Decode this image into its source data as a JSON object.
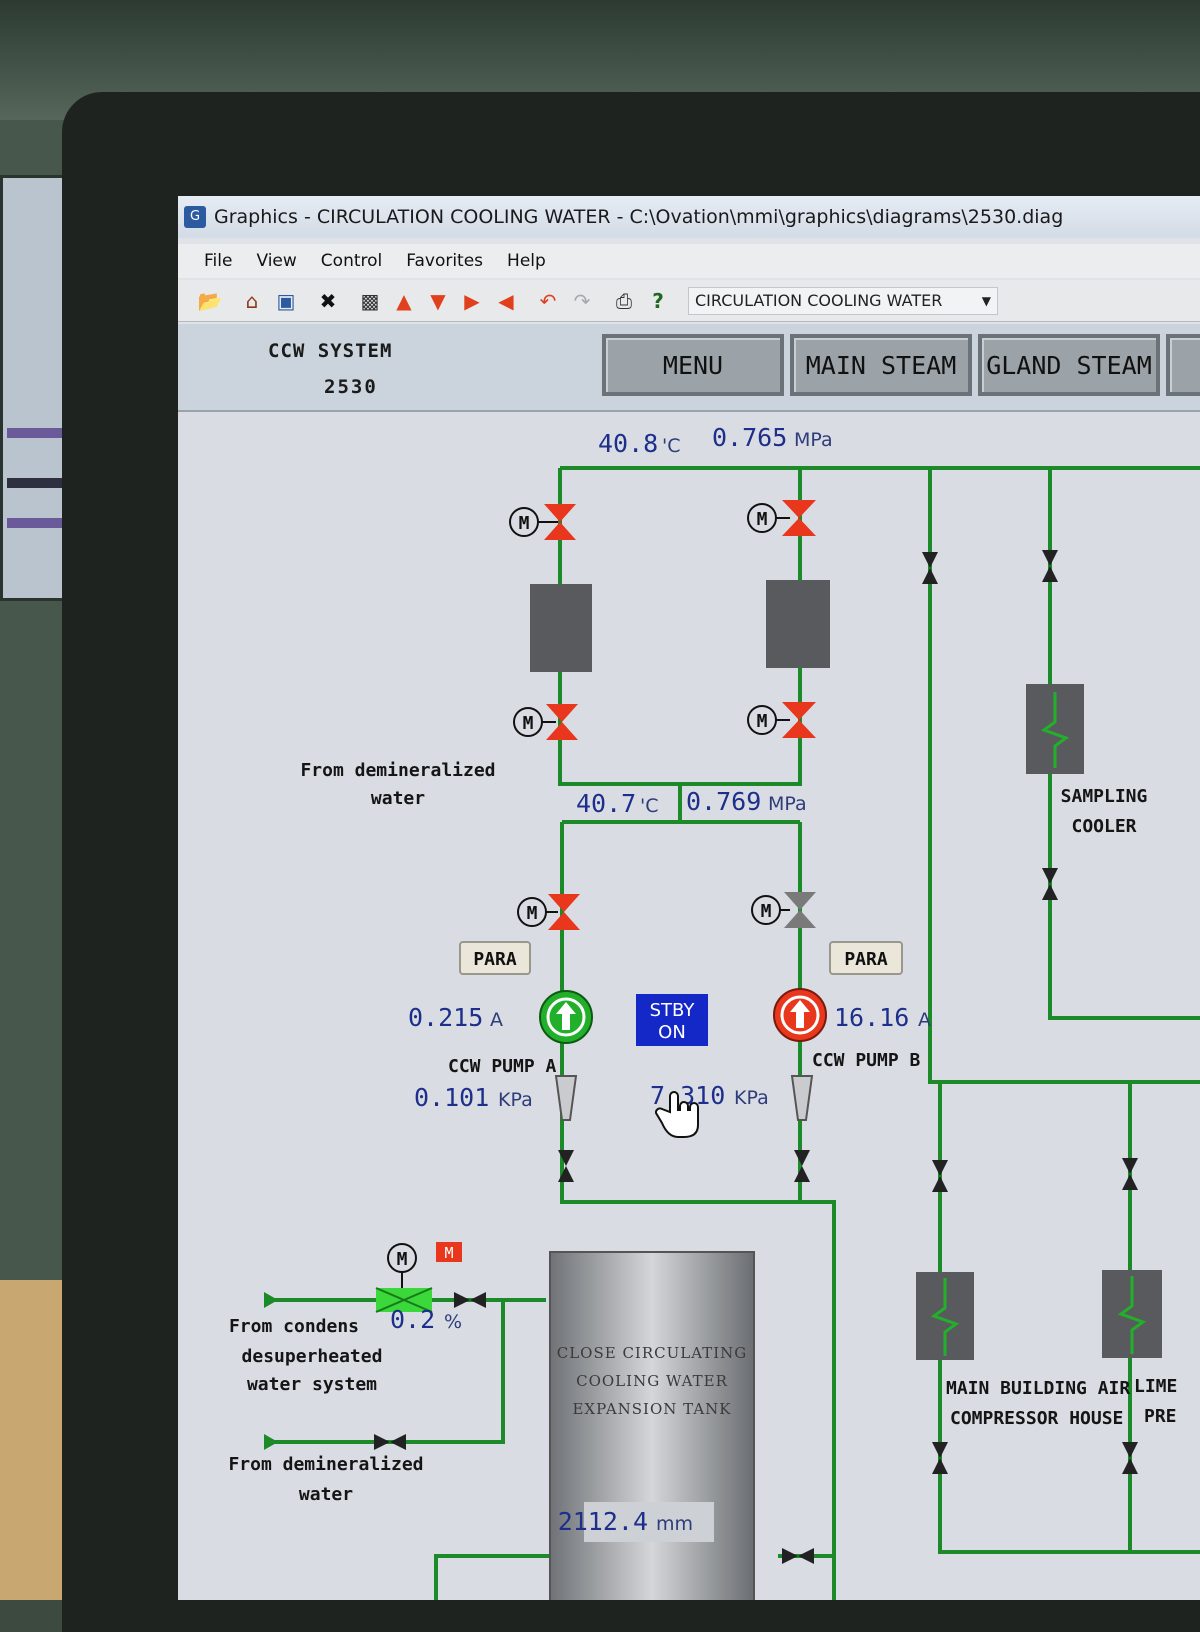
{
  "window": {
    "title": "Graphics - CIRCULATION COOLING WATER - C:\\Ovation\\mmi\\graphics\\diagrams\\2530.diag",
    "app_icon": "graphics-app-icon"
  },
  "menu": [
    "File",
    "View",
    "Control",
    "Favorites",
    "Help"
  ],
  "toolbar": {
    "icons": [
      "open-folder-icon",
      "home-icon",
      "snapshot-icon",
      "close-x-icon",
      "zoom-window-icon",
      "arrow-up-icon",
      "arrow-down-icon",
      "arrow-right-icon",
      "arrow-left-icon",
      "back-icon",
      "forward-icon",
      "print-icon",
      "help-icon"
    ],
    "diagram_select": "CIRCULATION COOLING WATER"
  },
  "header": {
    "system_label": "CCW SYSTEM",
    "system_number": "2530",
    "nav_buttons": [
      "MENU",
      "MAIN STEAM",
      "GLAND STEAM"
    ]
  },
  "readings": {
    "top_temp": "40.8",
    "top_temp_unit": "'C",
    "top_press": "0.765",
    "top_press_unit": "MPa",
    "mid_temp": "40.7",
    "mid_temp_unit": "'C",
    "mid_press": "0.769",
    "mid_press_unit": "MPa",
    "pump_a_current": "0.215",
    "pump_a_current_unit": "A",
    "pump_b_current": "16.16",
    "pump_b_current_unit": "A",
    "pump_a_dp": "0.101",
    "pump_a_dp_unit": "KPa",
    "pump_b_dp": "7.310",
    "pump_b_dp_unit": "KPa",
    "valve_position": "0.2",
    "valve_position_unit": "%",
    "tank_level": "2112.4",
    "tank_level_unit": "mm"
  },
  "labels": {
    "from_demin_1": [
      "From demineralized",
      "water"
    ],
    "from_condens": [
      "From condens",
      "desuperheated",
      "water system"
    ],
    "from_demin_2": [
      "From demineralized",
      "water"
    ],
    "sampling_cooler": [
      "SAMPLING",
      "COOLER"
    ],
    "main_building": [
      "MAIN BUILDING AIR",
      "COMPRESSOR HOUSE"
    ],
    "lime": [
      "LIME",
      "PRE"
    ],
    "pump_a": "CCW PUMP A",
    "pump_b": "CCW PUMP B",
    "para_a": "PARA",
    "para_b": "PARA",
    "standby": [
      "STBY",
      "ON"
    ],
    "motor_symbol": "M",
    "tank": [
      "CLOSE CIRCULATING",
      "COOLING WATER",
      "EXPANSION TANK"
    ]
  },
  "colors": {
    "pipe": "#1d8a2a",
    "valve_open": "#e8371c",
    "valve_closed": "#7a7a7a",
    "pump_running": "#e8371c",
    "pump_standby": "#22b02a",
    "value_text": "#1d2f8a",
    "standby_box": "#1428c8"
  }
}
